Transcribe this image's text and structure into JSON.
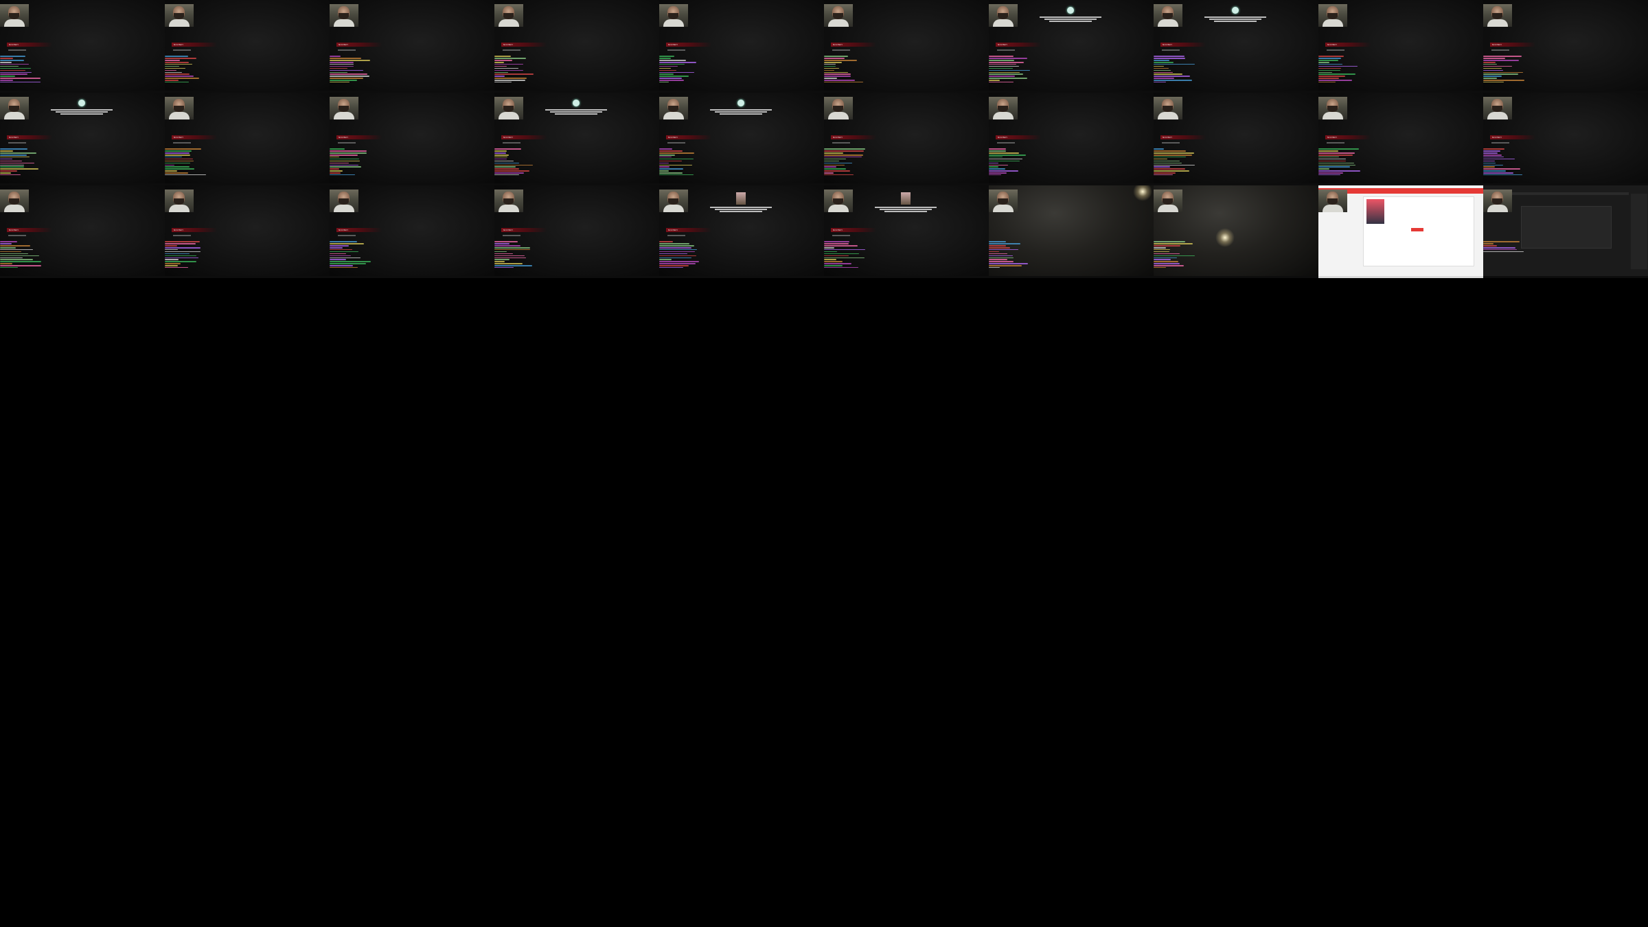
{
  "stream": {
    "banner_label": "NOVINKY",
    "tile_count": 30,
    "columns": 10,
    "rows": 3
  },
  "tiles": [
    {
      "kind": "stream",
      "qr": false,
      "notice": ""
    },
    {
      "kind": "stream",
      "qr": true,
      "notice": ""
    },
    {
      "kind": "stream",
      "qr": true,
      "notice": ""
    },
    {
      "kind": "stream",
      "qr": true,
      "notice": ""
    },
    {
      "kind": "stream",
      "qr": true,
      "notice": ""
    },
    {
      "kind": "stream",
      "qr": true,
      "notice": ""
    },
    {
      "kind": "stream",
      "qr": true,
      "notice": "dot"
    },
    {
      "kind": "stream",
      "qr": true,
      "notice": "dot"
    },
    {
      "kind": "stream",
      "qr": true,
      "notice": ""
    },
    {
      "kind": "stream",
      "qr": true,
      "notice": ""
    },
    {
      "kind": "stream",
      "qr": false,
      "notice": "dot"
    },
    {
      "kind": "stream",
      "qr": false,
      "notice": ""
    },
    {
      "kind": "stream",
      "qr": false,
      "notice": ""
    },
    {
      "kind": "stream",
      "qr": false,
      "notice": "dot"
    },
    {
      "kind": "stream",
      "qr": false,
      "notice": "dot"
    },
    {
      "kind": "stream",
      "qr": false,
      "notice": ""
    },
    {
      "kind": "stream",
      "qr": true,
      "notice": ""
    },
    {
      "kind": "stream",
      "qr": true,
      "notice": ""
    },
    {
      "kind": "stream",
      "qr": true,
      "notice": ""
    },
    {
      "kind": "stream",
      "qr": true,
      "notice": ""
    },
    {
      "kind": "stream",
      "qr": false,
      "notice": ""
    },
    {
      "kind": "stream",
      "qr": true,
      "notice": ""
    },
    {
      "kind": "stream",
      "qr": true,
      "notice": ""
    },
    {
      "kind": "stream",
      "qr": true,
      "notice": ""
    },
    {
      "kind": "stream",
      "qr": true,
      "notice": "avatar"
    },
    {
      "kind": "stream",
      "qr": true,
      "notice": "avatar"
    },
    {
      "kind": "game",
      "qr": false,
      "notice": ""
    },
    {
      "kind": "game",
      "qr": false,
      "notice": ""
    },
    {
      "kind": "browser",
      "qr": false,
      "notice": ""
    },
    {
      "kind": "editor",
      "qr": true,
      "notice": ""
    }
  ],
  "chat_palette": [
    "#3fbf5f",
    "#b86cff",
    "#e04a4a",
    "#e3d35c",
    "#c14ec9",
    "#4aa3e0",
    "#d08a3a",
    "#8fd18a",
    "#e2e2e2",
    "#ff6fb3"
  ],
  "colors": {
    "background": "#000000",
    "banner_red": "#7a0f18",
    "browser_red": "#e53935"
  }
}
